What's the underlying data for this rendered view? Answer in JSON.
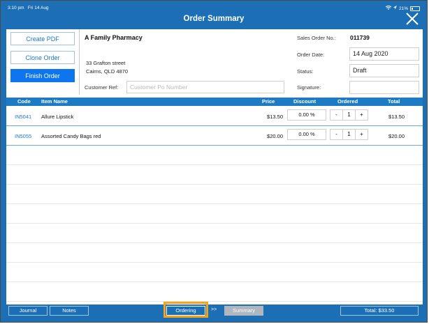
{
  "statusbar": {
    "time": "3:10 pm",
    "date": "Fri 14 Aug",
    "battery": "21%",
    "icons": [
      "wifi-icon",
      "location-icon",
      "battery-icon"
    ]
  },
  "header": {
    "title": "Order Summary"
  },
  "actions": {
    "create_pdf": "Create PDF",
    "clone_order": "Clone Order",
    "finish_order": "Finish Order"
  },
  "customer": {
    "name": "A Family Pharmacy",
    "address_line1": "33 Grafton street",
    "address_line2": "Cairns, QLD 4870",
    "ref_label": "Customer Ref:",
    "ref_placeholder": "Customer Po Number"
  },
  "order": {
    "so_label": "Sales Order No.:",
    "so_value": "011739",
    "date_label": "Order Date:",
    "date_value": "14 Aug 2020",
    "status_label": "Status:",
    "status_value": "Draft",
    "signature_label": "Signature:"
  },
  "table": {
    "columns": [
      "Code",
      "Item Name",
      "Price",
      "Discount",
      "Ordered",
      "Total"
    ],
    "rows": [
      {
        "code": "IN5041",
        "name": "Allure Lipstick",
        "price": "$13.50",
        "discount": "0.00 %",
        "qty": "1",
        "total": "$13.50"
      },
      {
        "code": "IN5055",
        "name": "Assorted Candy Bags red",
        "price": "$20.00",
        "discount": "0.00 %",
        "qty": "1",
        "total": "$20.00"
      }
    ],
    "minus": "-",
    "plus": "+"
  },
  "footer": {
    "journal": "Journal",
    "notes": "Notes",
    "ordering": "Ordering",
    "chevron": ">>",
    "summary": "Summary",
    "total": "Total: $33.50"
  },
  "colors": {
    "brand_blue": "#1d6fb5",
    "accent_blue": "#0d76ee",
    "highlight_orange": "#f6a316"
  }
}
